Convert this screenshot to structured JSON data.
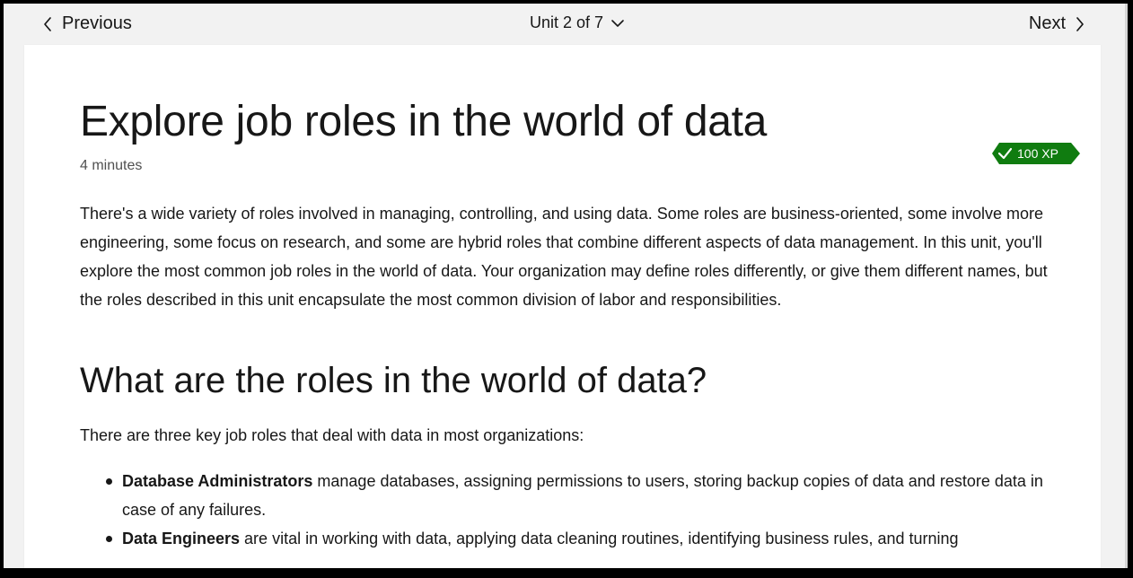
{
  "navigation": {
    "previous_label": "Previous",
    "unit_label": "Unit 2 of 7",
    "next_label": "Next",
    "previous_icon": "chevron-left-icon",
    "unit_icon": "chevron-down-icon",
    "next_icon": "chevron-right-icon"
  },
  "article": {
    "title": "Explore job roles in the world of data",
    "duration": "4 minutes",
    "xp_badge": "100 XP",
    "intro": "There's a wide variety of roles involved in managing, controlling, and using data. Some roles are business-oriented, some involve more engineering, some focus on research, and some are hybrid roles that combine different aspects of data management. In this unit, you'll explore the most common job roles in the world of data. Your organization may define roles differently, or give them different names, but the roles described in this unit encapsulate the most common division of labor and responsibilities.",
    "section_heading": "What are the roles in the world of data?",
    "section_intro": "There are three key job roles that deal with data in most organizations:",
    "roles": [
      {
        "name": "Database Administrators",
        "description": " manage databases, assigning permissions to users, storing backup copies of data and restore data in case of any failures."
      },
      {
        "name": "Data Engineers",
        "description": " are vital in working with data, applying data cleaning routines, identifying business rules, and turning"
      }
    ]
  },
  "colors": {
    "background": "#f2f2f2",
    "card": "#ffffff",
    "text": "#171717",
    "muted": "#505050",
    "xp_badge": "#107c10"
  }
}
